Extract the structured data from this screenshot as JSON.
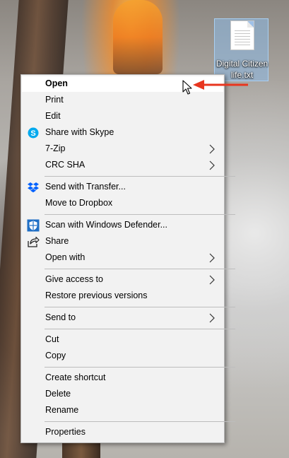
{
  "desktop": {
    "file_icon": {
      "name": "Digital Citizen life.txt",
      "icon": "text-file-icon"
    }
  },
  "context_menu": {
    "items": [
      {
        "label": "Open",
        "bold": true,
        "icon": null,
        "submenu": false
      },
      {
        "label": "Print",
        "bold": false,
        "icon": null,
        "submenu": false
      },
      {
        "label": "Edit",
        "bold": false,
        "icon": null,
        "submenu": false
      },
      {
        "label": "Share with Skype",
        "bold": false,
        "icon": "skype-icon",
        "submenu": false
      },
      {
        "label": "7-Zip",
        "bold": false,
        "icon": null,
        "submenu": true
      },
      {
        "label": "CRC SHA",
        "bold": false,
        "icon": null,
        "submenu": true
      },
      {
        "label": "Send with Transfer...",
        "bold": false,
        "icon": "dropbox-icon",
        "submenu": false
      },
      {
        "label": "Move to Dropbox",
        "bold": false,
        "icon": null,
        "submenu": false
      },
      {
        "label": "Scan with Windows Defender...",
        "bold": false,
        "icon": "windows-defender-icon",
        "submenu": false
      },
      {
        "label": "Share",
        "bold": false,
        "icon": "share-icon",
        "submenu": false
      },
      {
        "label": "Open with",
        "bold": false,
        "icon": null,
        "submenu": true
      },
      {
        "label": "Give access to",
        "bold": false,
        "icon": null,
        "submenu": true
      },
      {
        "label": "Restore previous versions",
        "bold": false,
        "icon": null,
        "submenu": false
      },
      {
        "label": "Send to",
        "bold": false,
        "icon": null,
        "submenu": true
      },
      {
        "label": "Cut",
        "bold": false,
        "icon": null,
        "submenu": false
      },
      {
        "label": "Copy",
        "bold": false,
        "icon": null,
        "submenu": false
      },
      {
        "label": "Create shortcut",
        "bold": false,
        "icon": null,
        "submenu": false
      },
      {
        "label": "Delete",
        "bold": false,
        "icon": null,
        "submenu": false
      },
      {
        "label": "Rename",
        "bold": false,
        "icon": null,
        "submenu": false
      },
      {
        "label": "Properties",
        "bold": false,
        "icon": null,
        "submenu": false
      }
    ]
  },
  "colors": {
    "menu_bg": "#f2f2f2",
    "separator": "#bdbdbd",
    "pointer_arrow": "#e8361f",
    "skype_blue": "#00a9ee",
    "dropbox_blue": "#0061fe",
    "defender_blue": "#1f6fc5"
  }
}
